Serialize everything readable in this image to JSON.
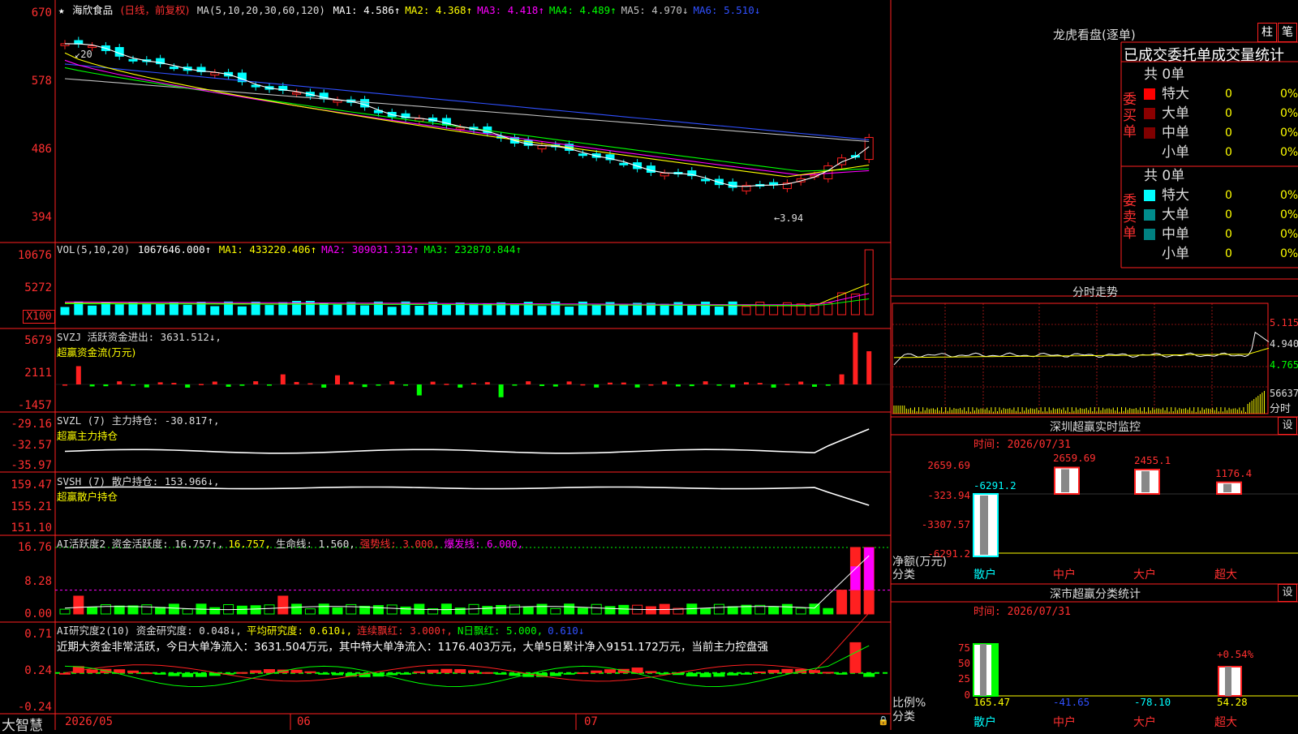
{
  "header": {
    "star": "★",
    "stock_name": "海欣食品",
    "period": "(日线，前复权)",
    "ma_label": "MA(5,10,20,30,60,120)",
    "ma": [
      {
        "text": "MA1: 4.586↑",
        "color": "#ffffff"
      },
      {
        "text": "MA2: 4.368↑",
        "color": "#ffff00"
      },
      {
        "text": "MA3: 4.418↑",
        "color": "#ff00ff"
      },
      {
        "text": "MA4: 4.489↑",
        "color": "#00ff00"
      },
      {
        "text": "MA5: 4.970↓",
        "color": "#c0c0c0"
      },
      {
        "text": "MA6: 5.510↓",
        "color": "#3050ff"
      }
    ]
  },
  "price_axis": [
    "670",
    "578",
    "486",
    "394"
  ],
  "price_annotations": {
    "high": "20",
    "low": "3.94"
  },
  "vol": {
    "axis": [
      "10676",
      "5272",
      "X100"
    ],
    "label": "VOL(5,10,20)",
    "value": "1067646.000↑",
    "ma": [
      {
        "text": "MA1: 433220.406↑",
        "color": "#ffff00"
      },
      {
        "text": "MA2: 309031.312↑",
        "color": "#ff00ff"
      },
      {
        "text": "MA3: 232870.844↑",
        "color": "#00ff00"
      }
    ]
  },
  "svzj": {
    "axis": [
      "5679",
      "2111",
      "-1457"
    ],
    "line1": "SVZJ  活跃资金进出: 3631.512↓,",
    "line2": "超赢资金流(万元)"
  },
  "svzl": {
    "axis": [
      "-29.16",
      "-32.57",
      "-35.97"
    ],
    "line1": "SVZL (7) 主力持仓: -30.817↑,",
    "line2": "超赢主力持仓"
  },
  "svsh": {
    "axis": [
      "159.47",
      "155.21",
      "151.10"
    ],
    "line1": "SVSH (7) 散户持仓: 153.966↓,",
    "line2": "超赢散户持仓"
  },
  "ai1": {
    "axis": [
      "16.76",
      "8.28",
      "0.00"
    ],
    "parts": [
      {
        "text": "AI活跃度2 资金活跃度: 16.757↑,",
        "color": "#dddddd"
      },
      {
        "text": "16.757,",
        "color": "#ffff00"
      },
      {
        "text": "生命线: 1.560,",
        "color": "#dddddd"
      },
      {
        "text": "强势线: 3.000,",
        "color": "#ff3030"
      },
      {
        "text": "爆发线: 6.000,",
        "color": "#ff00ff"
      }
    ]
  },
  "ai2": {
    "axis": [
      "0.71",
      "0.24",
      "-0.24"
    ],
    "parts": [
      {
        "text": "AI研究度2(10) 资金研究度: 0.048↓,",
        "color": "#dddddd"
      },
      {
        "text": "平均研究度: 0.610↓,",
        "color": "#ffff00"
      },
      {
        "text": "连续飘红: 3.000↑,",
        "color": "#ff3030"
      },
      {
        "text": "N日飘红: 5.000,",
        "color": "#00ff00"
      },
      {
        "text": "0.610↓",
        "color": "#3050ff"
      }
    ],
    "message": "近期大资金非常活跃，今日大单净流入：3631.504万元，其中特大单净流入：1176.403万元，大单5日累计净入9151.172万元，当前主力控盘强"
  },
  "date_axis": [
    "2026/05",
    "06",
    "07"
  ],
  "footer_brand": "大智慧",
  "right": {
    "lhb_title": "龙虎看盘(逐单)",
    "btn_zhu": "柱",
    "btn_bi": "笔",
    "order_title": "已成交委托单成交量统计",
    "buy_label": "委买单",
    "sell_label": "委卖单",
    "buy_total": "共 0单",
    "sell_total": "共 0单",
    "buy_rows": [
      {
        "label": "特大",
        "count": "0",
        "pct": "0%",
        "color": "#ff0000"
      },
      {
        "label": "大单",
        "count": "0",
        "pct": "0%",
        "color": "#8b0000"
      },
      {
        "label": "中单",
        "count": "0",
        "pct": "0%",
        "color": "#800000"
      },
      {
        "label": "小单",
        "count": "0",
        "pct": "0%",
        "color": ""
      }
    ],
    "sell_rows": [
      {
        "label": "特大",
        "count": "0",
        "pct": "0%",
        "color": "#00ffff"
      },
      {
        "label": "大单",
        "count": "0",
        "pct": "0%",
        "color": "#008b8b"
      },
      {
        "label": "中单",
        "count": "0",
        "pct": "0%",
        "color": "#008080"
      },
      {
        "label": "小单",
        "count": "0",
        "pct": "0%",
        "color": ""
      }
    ],
    "intraday_title": "分时走势",
    "intraday_axis": [
      "5.115",
      "4.940",
      "4.765"
    ],
    "intraday_vol": "56637",
    "intraday_vol_label": "分时",
    "sz_title": "深圳超赢实时监控",
    "sz_time": "时间: 2026/07/31",
    "sz_axis": [
      "2659.69",
      "-323.94",
      "-3307.57",
      "-6291.2"
    ],
    "sz_net_label": "净额(万元)",
    "sz_cat_label": "分类",
    "sz_cats": [
      "散户",
      "中户",
      "大户",
      "超大"
    ],
    "sz_values": [
      -6291.2,
      2659.69,
      2455.1,
      1176.4
    ],
    "sz_value_labels": [
      "-6291.2",
      "2659.69",
      "2455.1",
      "1176.4"
    ],
    "gear": "设",
    "fl_title": "深市超赢分类统计",
    "fl_time": "时间: 2026/07/31",
    "fl_axis": [
      "75",
      "50",
      "25",
      "0"
    ],
    "fl_ratio_label": "比例%",
    "fl_cat_label": "分类",
    "fl_cats": [
      "散户",
      "中户",
      "大户",
      "超大"
    ],
    "fl_values": [
      "165.47",
      "-41.65",
      "-78.10",
      "54.28"
    ],
    "fl_pct_label": "+0.54%"
  },
  "colors": {
    "border": "#ff2020",
    "up": "#ff2020",
    "down": "#00ffff",
    "green": "#00ff00"
  }
}
